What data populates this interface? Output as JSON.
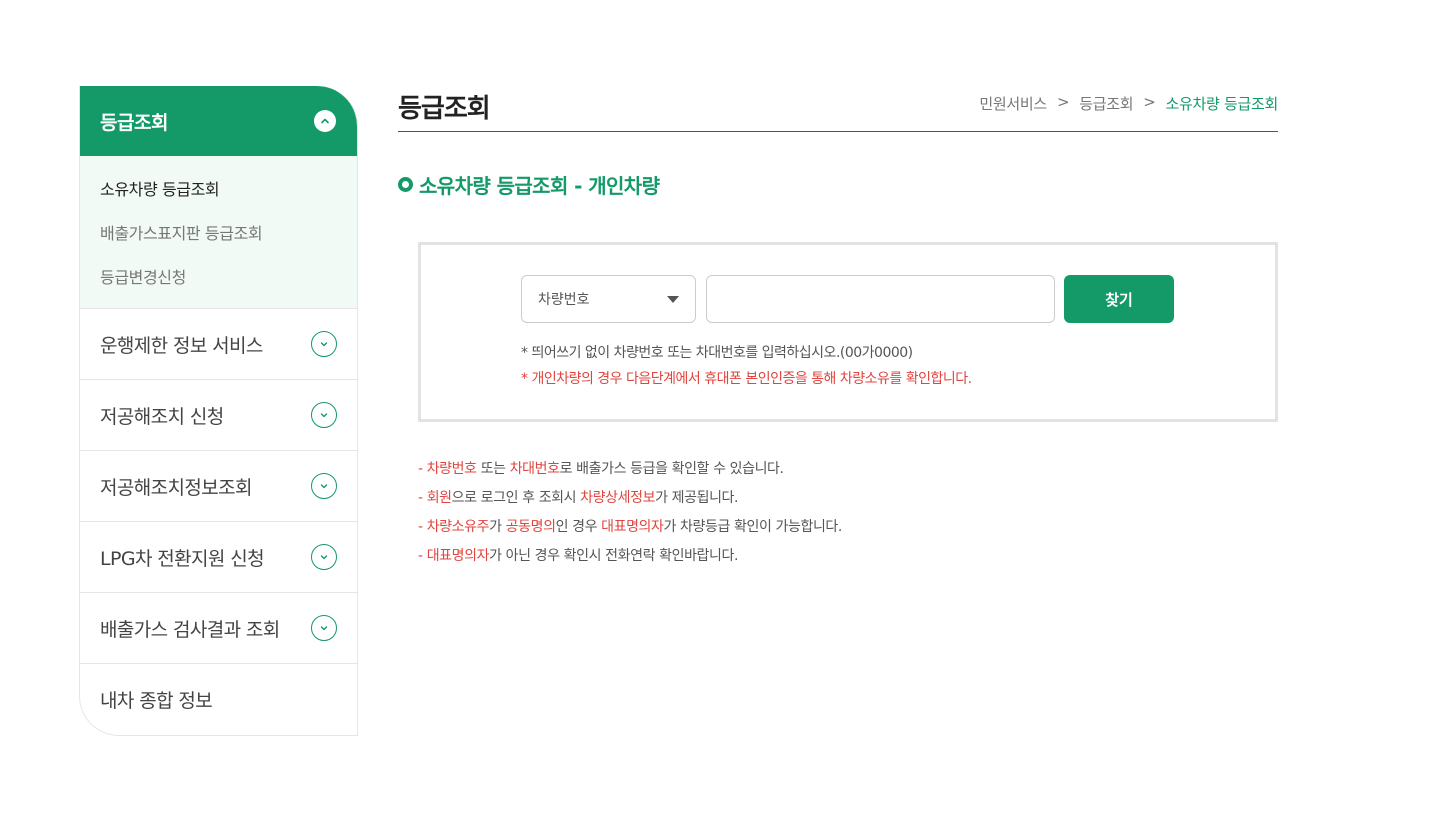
{
  "sidebar": {
    "header": {
      "title": "등급조회"
    },
    "sub_items": [
      {
        "label": "소유차량 등급조회",
        "active": true
      },
      {
        "label": "배출가스표지판 등급조회",
        "active": false
      },
      {
        "label": "등급변경신청",
        "active": false
      }
    ],
    "menu_items": [
      {
        "label": "운행제한 정보 서비스",
        "expandable": true
      },
      {
        "label": "저공해조치 신청",
        "expandable": true
      },
      {
        "label": "저공해조치정보조회",
        "expandable": true
      },
      {
        "label": "LPG차 전환지원 신청",
        "expandable": true
      },
      {
        "label": "배출가스 검사결과 조회",
        "expandable": true
      },
      {
        "label": "내차 종합 정보",
        "expandable": false
      }
    ]
  },
  "page": {
    "title": "등급조회",
    "breadcrumb": [
      "민원서비스",
      "등급조회",
      "소유차량 등급조회"
    ],
    "breadcrumb_separator": ">",
    "section_title": "소유차량 등급조회 - 개인차량"
  },
  "search": {
    "select_value": "차량번호",
    "input_value": "",
    "input_placeholder": "",
    "button_label": "찾기",
    "hint_normal": "* 띄어쓰기 없이 차량번호 또는 차대번호를 입력하십시오.(00가0000)",
    "hint_warning": "* 개인차량의 경우 다음단계에서 휴대폰 본인인증을 통해 차량소유를 확인합니다."
  },
  "notes": [
    {
      "parts": [
        {
          "text": "- ",
          "red": true
        },
        {
          "text": "차량번호",
          "red": true
        },
        {
          "text": " 또는 ",
          "red": false
        },
        {
          "text": "차대번호",
          "red": true
        },
        {
          "text": "로 배출가스 등급을 확인할 수 있습니다.",
          "red": false
        }
      ]
    },
    {
      "parts": [
        {
          "text": "- ",
          "red": true
        },
        {
          "text": "회원",
          "red": true
        },
        {
          "text": "으로 로그인 후 조회시 ",
          "red": false
        },
        {
          "text": "차량상세정보",
          "red": true
        },
        {
          "text": "가 제공됩니다.",
          "red": false
        }
      ]
    },
    {
      "parts": [
        {
          "text": "- ",
          "red": true
        },
        {
          "text": "차량소유주",
          "red": true
        },
        {
          "text": "가 ",
          "red": false
        },
        {
          "text": "공동명의",
          "red": true
        },
        {
          "text": "인 경우 ",
          "red": false
        },
        {
          "text": "대표명의자",
          "red": true
        },
        {
          "text": "가 차량등급 확인이 가능합니다.",
          "red": false
        }
      ]
    },
    {
      "parts": [
        {
          "text": "- ",
          "red": true
        },
        {
          "text": "대표명의자",
          "red": true
        },
        {
          "text": "가 아닌 경우 확인시 전화연락 확인바랍니다.",
          "red": false
        }
      ]
    }
  ],
  "icons": {
    "expand": "chevron-down-icon",
    "collapse": "chevron-up-icon",
    "dropdown": "caret-down-icon",
    "section": "ring-bullet-icon"
  },
  "colors": {
    "brand_green": "#139a68",
    "submenu_bg": "#f2faf6",
    "warning_red": "#e0453f"
  }
}
